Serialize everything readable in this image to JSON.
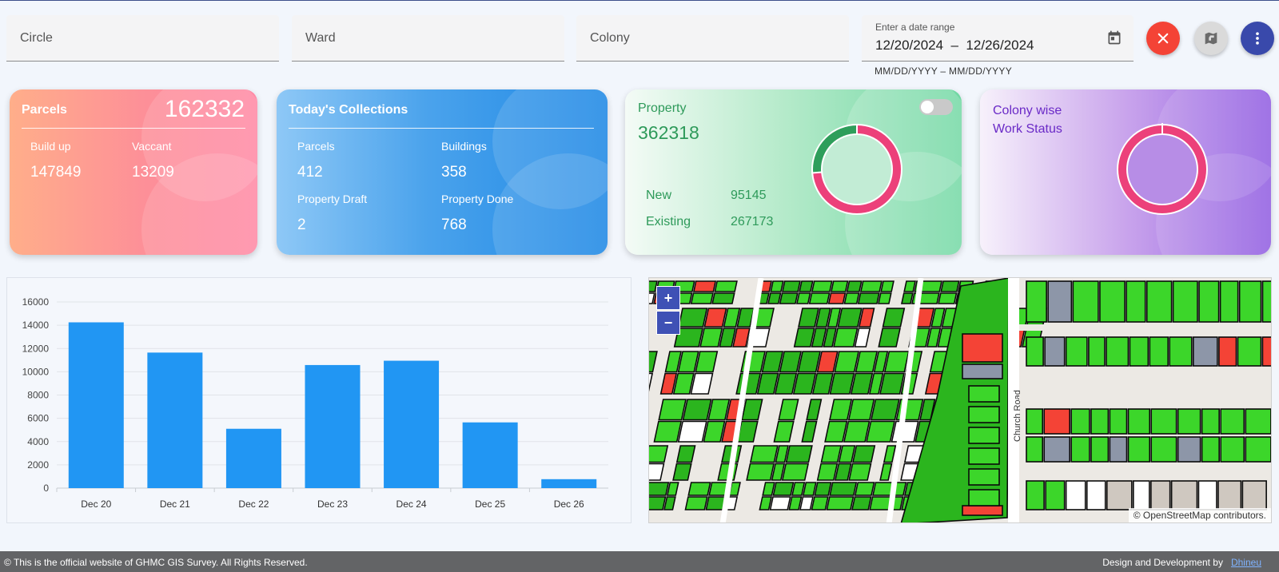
{
  "filters": {
    "circle_placeholder": "Circle",
    "ward_placeholder": "Ward",
    "colony_placeholder": "Colony",
    "date_label": "Enter a date range",
    "date_value": "12/20/2024  –  12/26/2024",
    "date_hint": "MM/DD/YYYY – MM/DD/YYYY"
  },
  "icons": {
    "clear": "close-icon",
    "map": "map-icon",
    "more": "more-vertical-icon",
    "calendar": "calendar-icon"
  },
  "parcels": {
    "title": "Parcels",
    "total": "162332",
    "buildup_label": "Build up",
    "buildup_value": "147849",
    "vacant_label": "Vaccant",
    "vacant_value": "13209"
  },
  "collections": {
    "title": "Today's Collections",
    "parcels_label": "Parcels",
    "parcels_value": "412",
    "buildings_label": "Buildings",
    "buildings_value": "358",
    "draft_label": "Property Draft",
    "draft_value": "2",
    "done_label": "Property Done",
    "done_value": "768"
  },
  "property": {
    "title": "Property",
    "total": "362318",
    "new_label": "New",
    "new_value": "95145",
    "existing_label": "Existing",
    "existing_value": "267173",
    "toggle_on": false,
    "donut": {
      "new_fraction": 0.2626,
      "colors": [
        "#ec407a",
        "#2e9e5b"
      ]
    }
  },
  "colony": {
    "title_line1": "Colony wise",
    "title_line2": "Work Status",
    "donut_color": "#ec407a"
  },
  "chart_data": {
    "type": "bar",
    "categories": [
      "Dec 20",
      "Dec 21",
      "Dec 22",
      "Dec 23",
      "Dec 24",
      "Dec 25",
      "Dec 26"
    ],
    "values": [
      14250,
      11650,
      5100,
      10580,
      10950,
      5650,
      768
    ],
    "ylim": [
      0,
      16000
    ],
    "yticks": [
      0,
      2000,
      4000,
      6000,
      8000,
      10000,
      12000,
      14000,
      16000
    ],
    "grid": true,
    "color": "#2196f3"
  },
  "map": {
    "zoom_in": "+",
    "zoom_out": "−",
    "road_label": "Church Road",
    "attribution": "© OpenStreetMap contributors."
  },
  "footer": {
    "left": "© This is the official website of GHMC GIS Survey. All Rights Reserved.",
    "right": "Design and Development by",
    "link": "Dhineu"
  }
}
